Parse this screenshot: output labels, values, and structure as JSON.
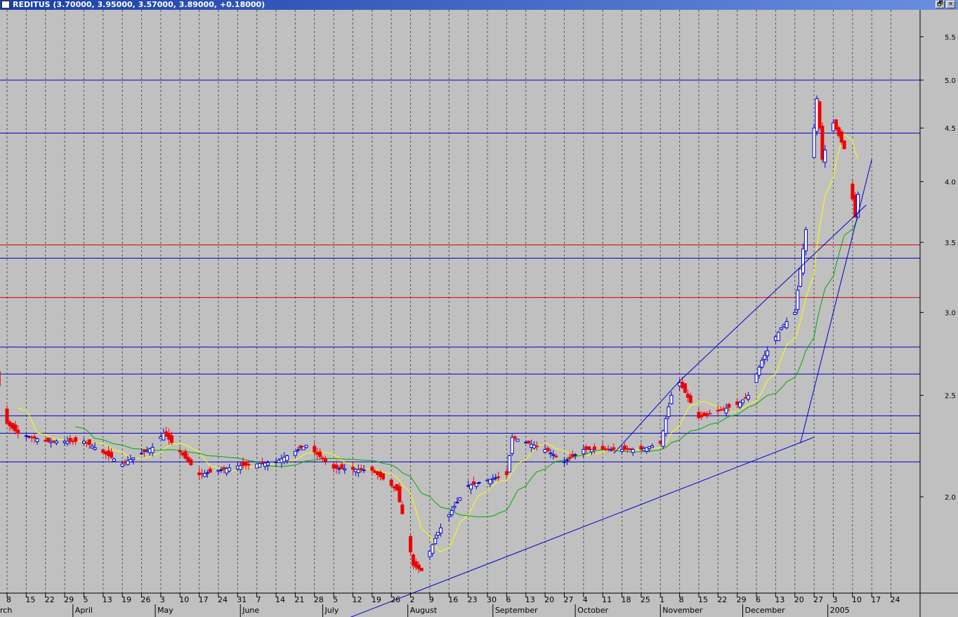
{
  "window": {
    "title": "REDITUS (3.70000, 3.95000, 3.57000, 3.89000, +0.18000)",
    "restore_label": "🗗",
    "close_label": "×"
  },
  "colors": {
    "background": "#c0c0c0",
    "up_candle": "#0000cc",
    "down_candle": "#ee0000",
    "ma_short": "#ffff00",
    "ma_long": "#00aa00",
    "support_lines": "#0000cc",
    "red_levels": "#dd0000",
    "trendlines": "#0000cc"
  },
  "chart_data": {
    "type": "candlestick",
    "title": "REDITUS",
    "last_ohlc": {
      "open": 3.7,
      "high": 3.95,
      "low": 3.57,
      "close": 3.89,
      "change": 0.18
    },
    "y_axis": {
      "scale": "log",
      "range": [
        1.55,
        5.8
      ],
      "ticks": [
        2.0,
        2.5,
        3.0,
        3.5,
        4.0,
        4.5,
        5.0,
        5.5
      ],
      "tick_labels": [
        "2.0",
        "2.5",
        "3.0",
        "3.5",
        "4.0",
        "4.5",
        "5.0",
        "5.5"
      ]
    },
    "x_axis": {
      "day_labels": [
        "8",
        "15",
        "22",
        "29",
        "5",
        "13",
        "19",
        "26",
        "3",
        "10",
        "17",
        "24",
        "31",
        "7",
        "14",
        "21",
        "28",
        "5",
        "12",
        "19",
        "26",
        "2",
        "9",
        "16",
        "23",
        "30",
        "6",
        "13",
        "20",
        "27",
        "4",
        "11",
        "18",
        "25",
        "1",
        "8",
        "15",
        "22",
        "29",
        "6",
        "13",
        "20",
        "27",
        "3",
        "10",
        "17",
        "24"
      ],
      "month_labels": [
        "rch",
        "April",
        "May",
        "June",
        "July",
        "August",
        "September",
        "October",
        "November",
        "December",
        "2005"
      ]
    },
    "horizontal_levels": {
      "blue": [
        5.0,
        4.45,
        3.38,
        2.78,
        2.62,
        2.39,
        2.3,
        2.16
      ],
      "red": [
        3.48,
        3.1
      ]
    },
    "trendlines": [
      {
        "from": [
          "2004-07-07",
          1.52
        ],
        "to": [
          "2004-12-27",
          2.28
        ]
      },
      {
        "from": [
          "2004-10-15",
          2.2
        ],
        "to": [
          "2004-11-08",
          2.58
        ]
      },
      {
        "from": [
          "2004-11-08",
          2.58
        ],
        "to": [
          "2005-01-15",
          3.8
        ]
      },
      {
        "from": [
          "2004-12-22",
          2.25
        ],
        "to": [
          "2005-01-17",
          4.2
        ]
      }
    ],
    "key_points": [
      {
        "date": "2004-03-08",
        "close": 2.6
      },
      {
        "date": "2004-08-06",
        "low": 1.7
      },
      {
        "date": "2004-11-08",
        "high": 2.6
      },
      {
        "date": "2004-12-29",
        "high": 5.25
      },
      {
        "date": "2005-01-12",
        "close": 3.89
      }
    ]
  }
}
